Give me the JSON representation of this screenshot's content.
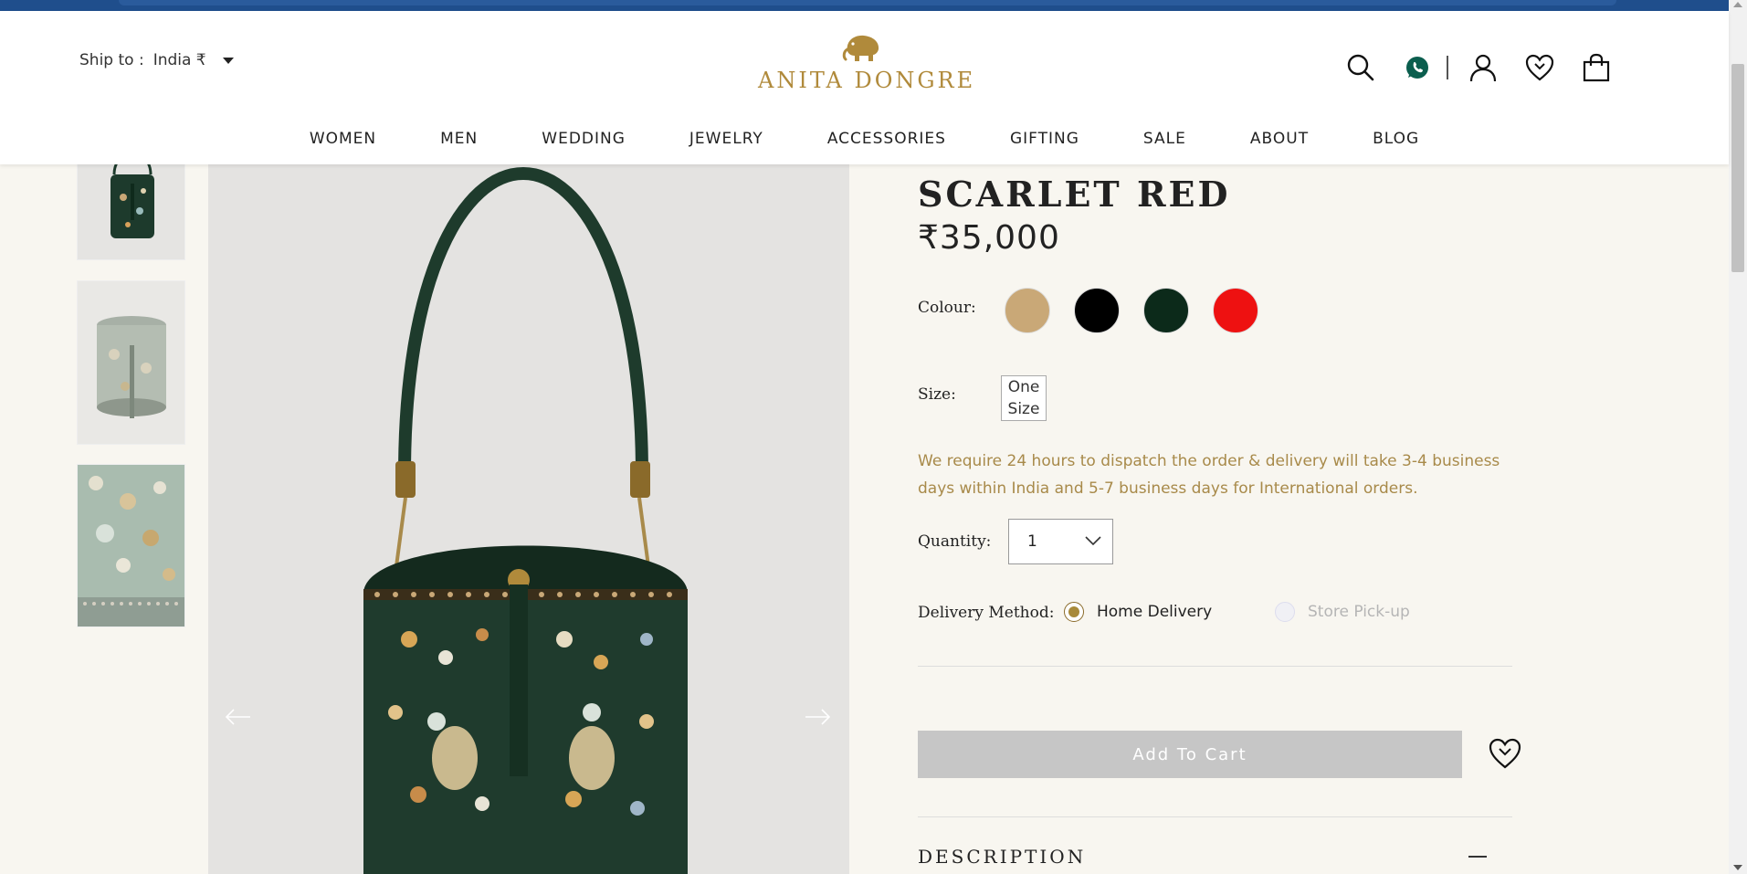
{
  "header": {
    "ship_to_label": "Ship to :",
    "country": "India ₹",
    "brand": "ANITA DONGRE",
    "icons": [
      "search-icon",
      "whatsapp-icon",
      "user-icon",
      "wishlist-icon",
      "bag-icon"
    ]
  },
  "nav": {
    "items": [
      "WOMEN",
      "MEN",
      "WEDDING",
      "JEWELRY",
      "ACCESSORIES",
      "GIFTING",
      "SALE",
      "ABOUT",
      "BLOG"
    ]
  },
  "product": {
    "title": "SCARLET RED",
    "price": "₹35,000",
    "colour_label": "Colour:",
    "colours": [
      "#c9a877",
      "#000000",
      "#0c2a1a",
      "#ee1111"
    ],
    "size_label": "Size:",
    "size_value": "One Size",
    "dispatch_note": "We require 24 hours to dispatch the order & delivery will take 3-4 business days within India and 5-7 business days for International orders.",
    "quantity_label": "Quantity:",
    "quantity_value": "1",
    "delivery_label": "Delivery Method:",
    "delivery_home": "Home Delivery",
    "delivery_store": "Store Pick-up",
    "add_to_cart": "Add To Cart",
    "description_label": "DESCRIPTION"
  },
  "colors": {
    "accent_gold": "#b08a3b",
    "top_bar": "#1f4e8c",
    "whatsapp": "#0b5e4e"
  }
}
